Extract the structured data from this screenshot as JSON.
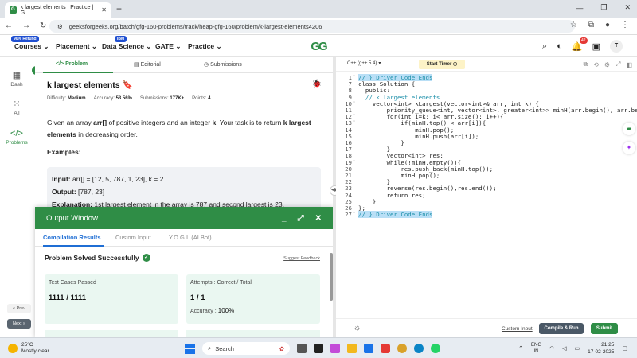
{
  "browser": {
    "tab_title": "k largest elements | Practice | G",
    "url": "geeksforgeeks.org/batch/gfg-160-problems/track/heap-gfg-160/problem/k-largest-elements4206"
  },
  "site_nav": {
    "items": [
      {
        "label": "Courses",
        "badge": "90% Refund"
      },
      {
        "label": "Placement"
      },
      {
        "label": "Data Science",
        "badge": "IBM"
      },
      {
        "label": "GATE"
      },
      {
        "label": "Practice"
      }
    ],
    "logo": "GG",
    "notification_count": "42",
    "avatar": "T",
    "colors": {
      "brand": "#2f8d46",
      "badge_red": "#e53935",
      "badge_blue": "#1f4fd1"
    }
  },
  "rail": {
    "items": [
      {
        "label": "Dash"
      },
      {
        "label": "All"
      },
      {
        "label": "Problems"
      }
    ],
    "prev_label": "« Prev",
    "next_label": "Next »"
  },
  "problem_tabs": [
    "Problem",
    "Editorial",
    "Submissions"
  ],
  "problem": {
    "title": "k largest elements",
    "difficulty_label": "Difficulty:",
    "difficulty": "Medium",
    "accuracy_label": "Accuracy:",
    "accuracy": "53.56%",
    "submissions_label": "Submissions:",
    "submissions": "177K+",
    "points_label": "Points:",
    "points": "4",
    "desc_1": "Given an array ",
    "desc_arr": "arr[]",
    "desc_2": " of positive integers and an integer ",
    "desc_k": "k",
    "desc_3": ", Your task is to return ",
    "desc_bold": "k largest elements",
    "desc_4": " in decreasing order.",
    "examples_heading": "Examples:",
    "ex_input_label": "Input:",
    "ex_input": " arr[] = [12, 5, 787, 1, 23], k = 2",
    "ex_output_label": "Output:",
    "ex_output": " [787, 23]",
    "ex_expl_label": "Explanation:",
    "ex_expl": " 1st largest element in the array is 787 and second largest is 23."
  },
  "output_window": {
    "title": "Output Window",
    "tabs": [
      "Compilation Results",
      "Custom Input",
      "Y.O.G.I. (AI Bot)"
    ],
    "status": "Problem Solved Successfully",
    "feedback_link": "Suggest Feedback",
    "test_cases_label": "Test Cases Passed",
    "test_cases_value": "1111 / 1111",
    "attempts_label": "Attempts : Correct / Total",
    "attempts_value": "1 / 1",
    "accuracy_label": "Accuracy :",
    "accuracy_value": "100%"
  },
  "editor": {
    "language": "C++ (g++ 5.4)",
    "timer_label": "Start Timer",
    "lines": [
      {
        "n": "1",
        "fold": "▾",
        "text": "// } Driver Code Ends",
        "hl": true
      },
      {
        "n": "7",
        "fold": "",
        "text": "class Solution {"
      },
      {
        "n": "8",
        "fold": "",
        "text": "  public:"
      },
      {
        "n": "9",
        "fold": "",
        "text": "  // k largest elements"
      },
      {
        "n": "10",
        "fold": "▾",
        "text": "    vector<int> kLargest(vector<int>& arr, int k) {"
      },
      {
        "n": "11",
        "fold": "",
        "text": "        priority_queue<int, vector<int>, greater<int>> minH(arr.begin(), arr.begin()+k);"
      },
      {
        "n": "12",
        "fold": "▾",
        "text": "        for(int i=k; i< arr.size(); i++){"
      },
      {
        "n": "13",
        "fold": "▾",
        "text": "            if(minH.top() < arr[i]){"
      },
      {
        "n": "14",
        "fold": "",
        "text": "                minH.pop();"
      },
      {
        "n": "15",
        "fold": "",
        "text": "                minH.push(arr[i]);"
      },
      {
        "n": "16",
        "fold": "",
        "text": "            }"
      },
      {
        "n": "17",
        "fold": "",
        "text": "        }"
      },
      {
        "n": "18",
        "fold": "",
        "text": "        vector<int> res;"
      },
      {
        "n": "19",
        "fold": "▾",
        "text": "        while(!minH.empty()){"
      },
      {
        "n": "20",
        "fold": "",
        "text": "            res.push_back(minH.top());"
      },
      {
        "n": "21",
        "fold": "",
        "text": "            minH.pop();"
      },
      {
        "n": "22",
        "fold": "",
        "text": "        }"
      },
      {
        "n": "23",
        "fold": "",
        "text": "        reverse(res.begin(),res.end());"
      },
      {
        "n": "24",
        "fold": "",
        "text": "        return res;"
      },
      {
        "n": "25",
        "fold": "",
        "text": "    }"
      },
      {
        "n": "26",
        "fold": "",
        "text": "};"
      },
      {
        "n": "27",
        "fold": "▾",
        "text": "// } Driver Code Ends",
        "hl": true
      }
    ],
    "custom_input": "Custom Input",
    "compile_label": "Compile & Run",
    "submit_label": "Submit"
  },
  "taskbar": {
    "temp": "25°C",
    "weather": "Mostly clear",
    "search_placeholder": "Search",
    "lang_line1": "ENG",
    "lang_line2": "IN",
    "time": "21:25",
    "date": "17-02-2025"
  }
}
